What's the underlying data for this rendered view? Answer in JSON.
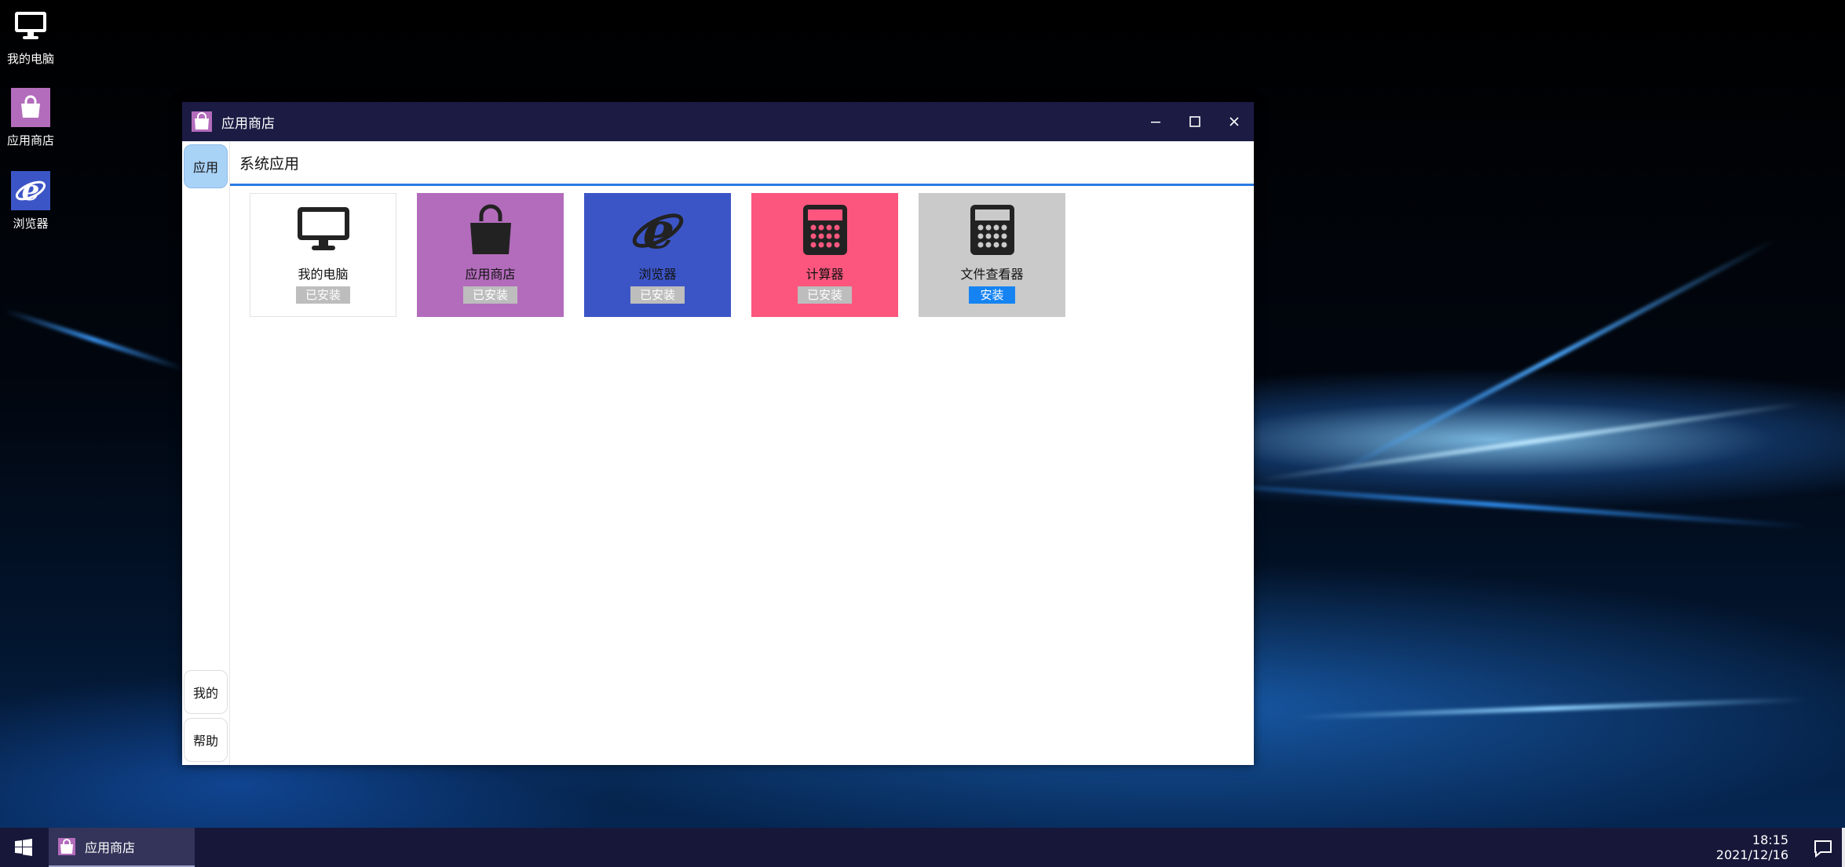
{
  "desktop": {
    "icons": [
      {
        "label": "我的电脑"
      },
      {
        "label": "应用商店"
      },
      {
        "label": "浏览器"
      }
    ]
  },
  "window": {
    "title": "应用商店",
    "controls": {
      "minimize": "minimize-icon",
      "maximize": "maximize-icon",
      "close": "close-icon"
    },
    "sidebar": {
      "top": [
        {
          "label": "应用",
          "active": true
        }
      ],
      "bottom": [
        {
          "label": "我的"
        },
        {
          "label": "帮助"
        }
      ]
    },
    "section_title": "系统应用",
    "accent_color": "#2a7be0",
    "apps": [
      {
        "name": "我的电脑",
        "status": "已安装",
        "bg": "#ffffff",
        "icon": "monitor-icon"
      },
      {
        "name": "应用商店",
        "status": "已安装",
        "bg": "#b36cbc",
        "icon": "shopping-bag-icon"
      },
      {
        "name": "浏览器",
        "status": "已安装",
        "bg": "#3c55c6",
        "icon": "ie-browser-icon"
      },
      {
        "name": "计算器",
        "status": "已安装",
        "bg": "#fc567e",
        "icon": "calculator-icon"
      },
      {
        "name": "文件查看器",
        "status": "安装",
        "bg": "#cacaca",
        "icon": "calculator-icon"
      }
    ]
  },
  "taskbar": {
    "active_app": "应用商店",
    "time": "18:15",
    "date": "2021/12/16"
  }
}
